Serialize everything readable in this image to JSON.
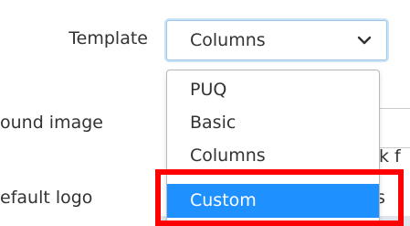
{
  "form": {
    "template_label": "Template",
    "background_label": "ound image",
    "logo_label": "efault logo",
    "background_input_text": "k f",
    "logo_input_text": "us"
  },
  "select": {
    "value": "Columns",
    "icon": "chevron-down-icon"
  },
  "dropdown": {
    "options": [
      "PUQ",
      "Basic",
      "Columns",
      "Custom"
    ],
    "highlighted_option": "Custom",
    "highlight_color": "#1e90ff"
  },
  "annotation": {
    "box_color": "#ff0000"
  }
}
